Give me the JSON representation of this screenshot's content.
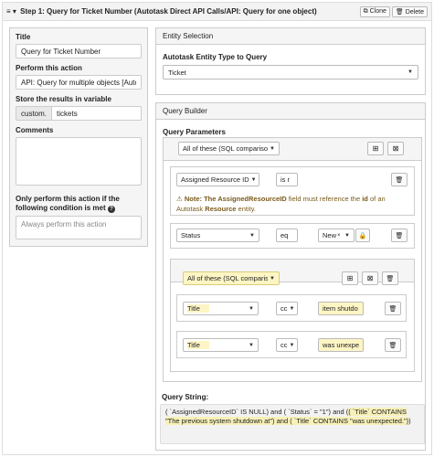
{
  "step": {
    "menu_icon": "≡ ▾",
    "title": "Step 1: Query for Ticket Number (Autotask Direct API Calls/API: Query for one object)",
    "clone_label": "Clone",
    "delete_label": "Delete"
  },
  "left": {
    "title_label": "Title",
    "title_value": "Query for Ticket Number",
    "action_label": "Perform this action",
    "action_value": "API: Query for multiple objects [Autotask",
    "store_label": "Store the results in variable",
    "store_prefix": "custom.",
    "store_value": "tickets",
    "comments_label": "Comments",
    "condition_label": "Only perform this action if the following condition is met",
    "condition_placeholder": "Always perform this action"
  },
  "entity": {
    "heading": "Entity Selection",
    "type_label": "Autotask Entity Type to Query",
    "type_value": "Ticket"
  },
  "builder": {
    "heading": "Query Builder",
    "params_label": "Query Parameters",
    "group_mode": "All of these (SQL comparison 'and')",
    "rule1": {
      "field": "Assigned Resource ID",
      "op": "is r",
      "note_prefix": "Note: The ",
      "note_field": "AssignedResourceID",
      "note_mid": " field must reference the ",
      "note_id": "id",
      "note_mid2": " of an Autotask ",
      "note_entity": "Resource",
      "note_suffix": " entity."
    },
    "rule2": {
      "field": "Status",
      "op": "eq",
      "value": "New"
    },
    "nested_group_mode": "All of these (SQL comparison 'a",
    "rule3": {
      "field": "Title",
      "op": "cc",
      "value": "item shutdo"
    },
    "rule4": {
      "field": "Title",
      "op": "cc",
      "value": "was unexpe"
    },
    "query_string_label": "Query String:",
    "query_string_part1": "( `AssignedResourceID` IS NULL) and ( `Status` = \"1\") and (",
    "query_string_part2": "( `Title` CONTAINS \"The previous system shutdown at\") and ( `Title` CONTAINS \"was unexpected.\")",
    "query_string_part3": ")"
  }
}
